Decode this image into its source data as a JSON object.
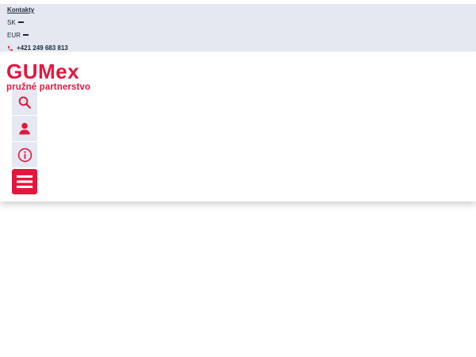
{
  "topbar": {
    "contacts_label": "Kontakty",
    "language": "SK",
    "currency": "EUR",
    "phone": "+421 249 683 813"
  },
  "header": {
    "logo_text": "GUMex",
    "logo_tagline": "pružné partnerstvo"
  },
  "icons": [
    "search-icon",
    "user-icon",
    "info-icon",
    "menu-icon"
  ],
  "colors": {
    "brand": "#e3173e",
    "topbar_bg": "#e5e8f0",
    "text": "#1c2b3a"
  }
}
